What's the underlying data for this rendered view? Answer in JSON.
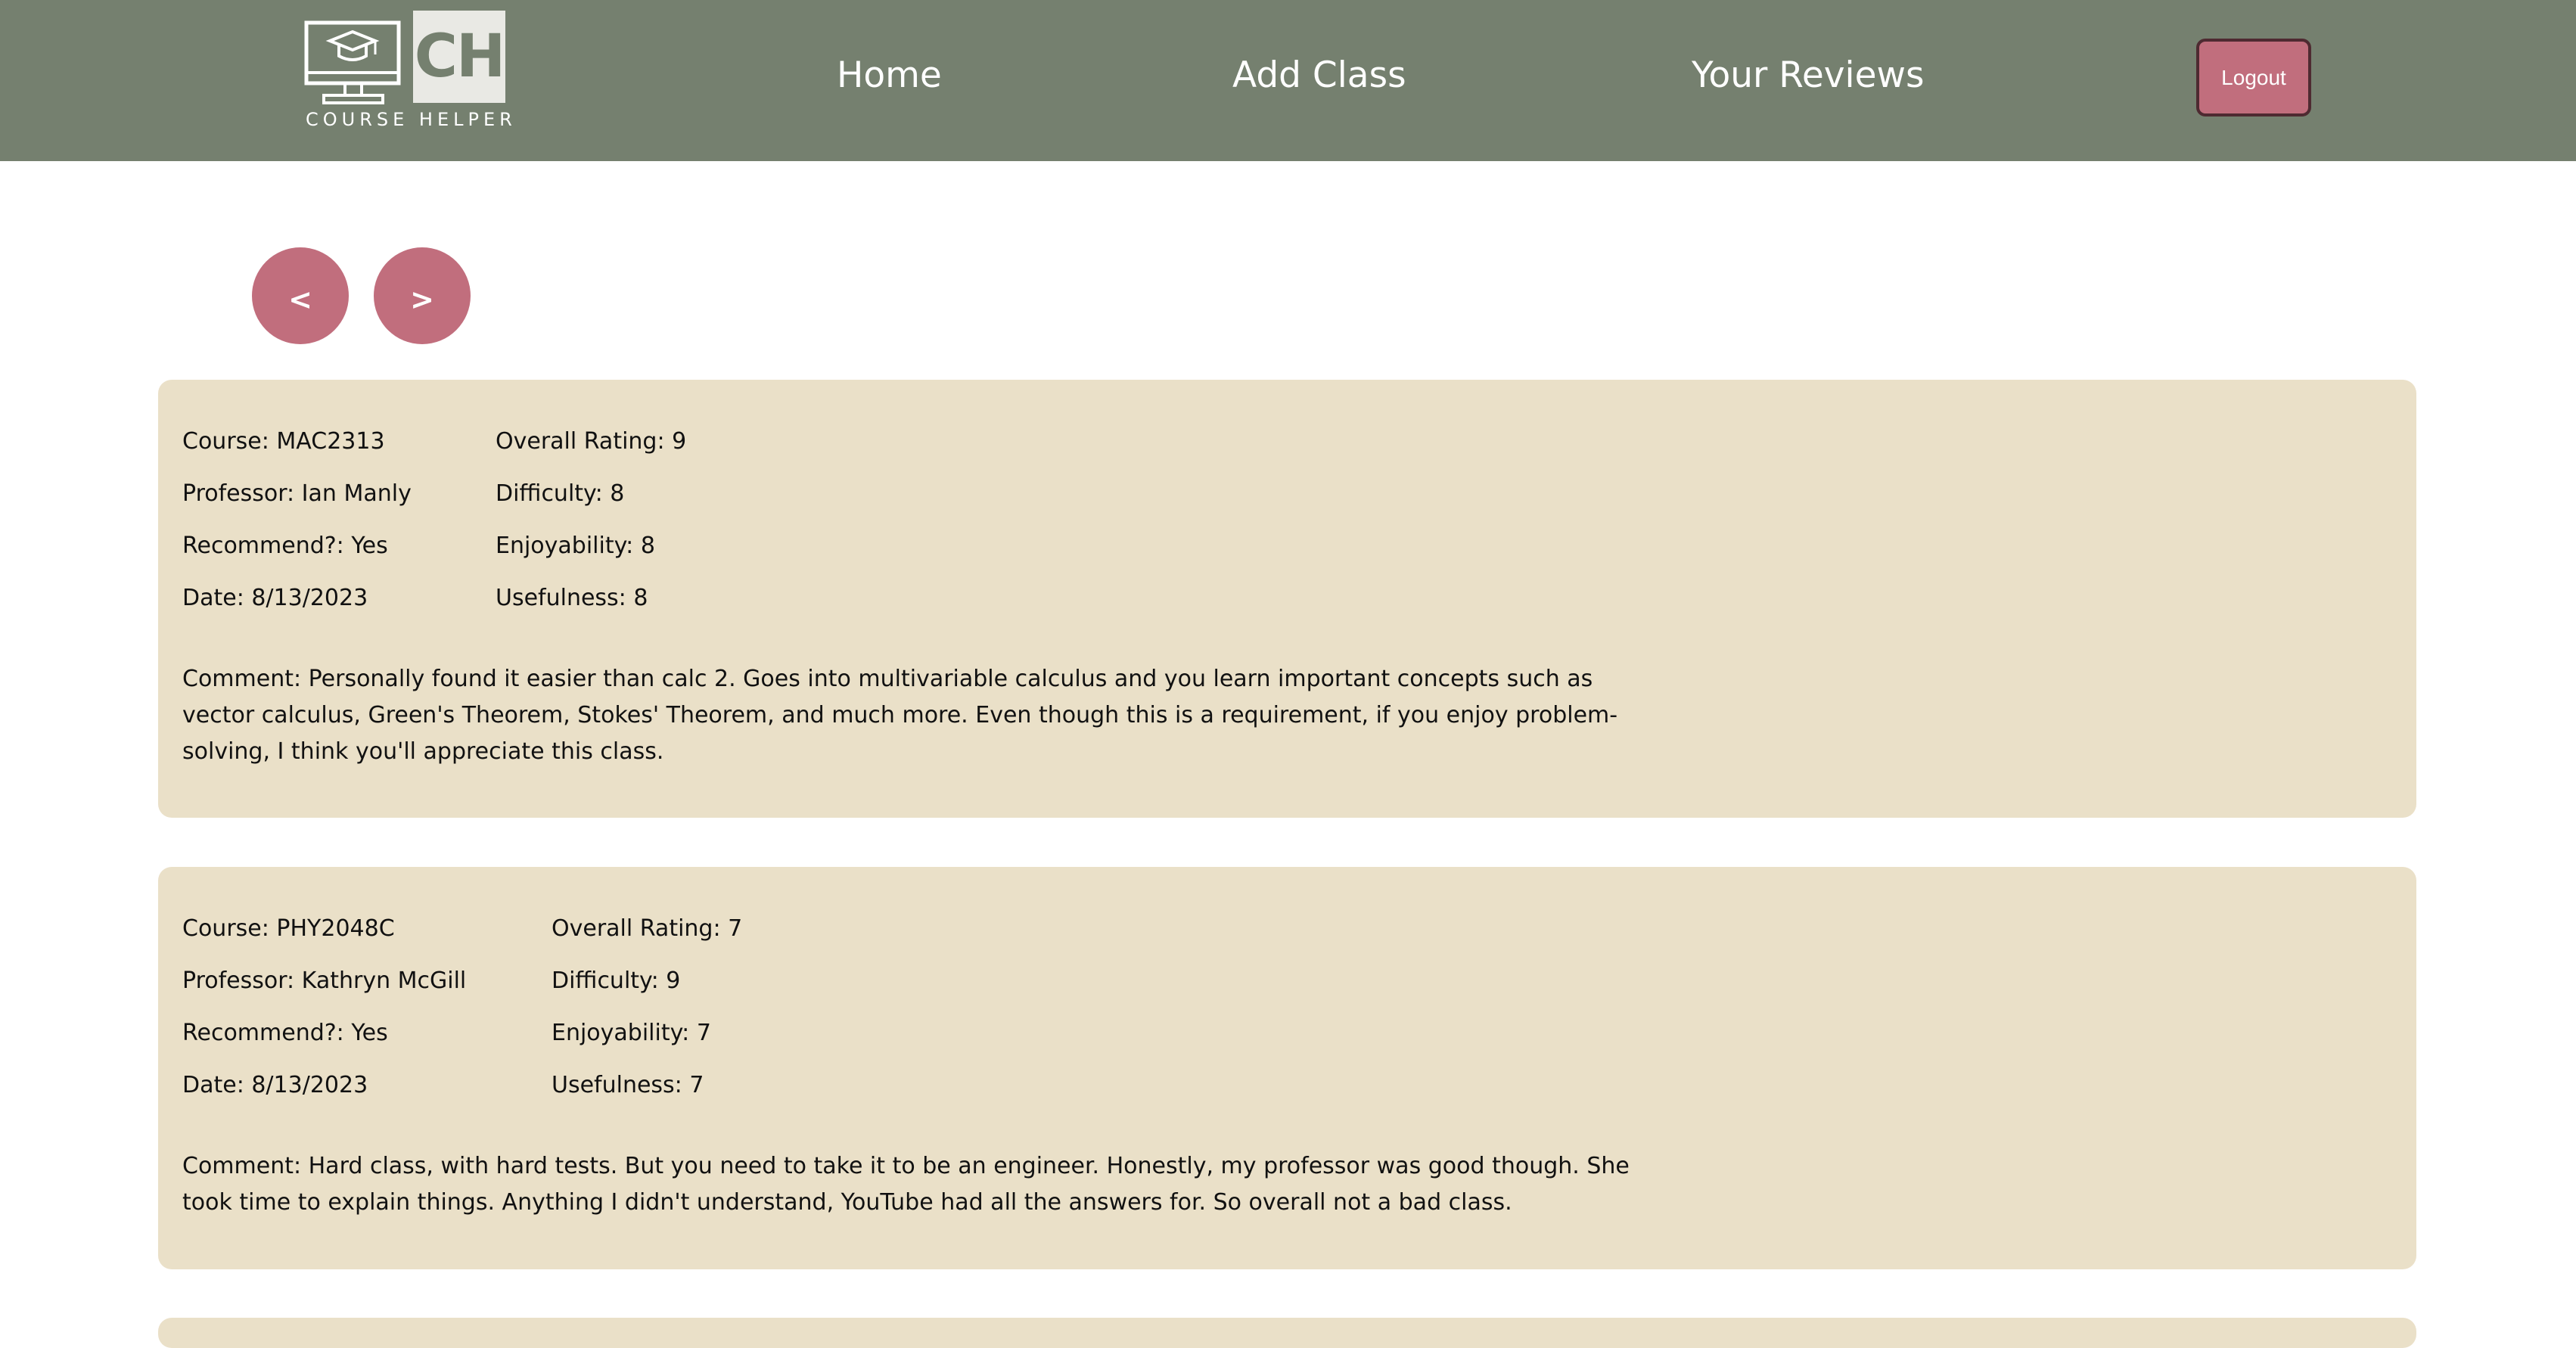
{
  "header": {
    "logo_text": "COURSE HELPER",
    "logo_initials": "CH",
    "nav": {
      "home": "Home",
      "add_class": "Add Class",
      "your_reviews": "Your Reviews"
    },
    "logout_label": "Logout"
  },
  "pager": {
    "prev_label": "<",
    "next_label": ">"
  },
  "colors": {
    "header_bg": "#75806f",
    "accent": "#c16e7d",
    "card_bg": "#eae0c8"
  },
  "reviews": [
    {
      "course": "Course: MAC2313",
      "professor": "Professor: Ian Manly",
      "recommend": "Recommend?: Yes",
      "date": "Date: 8/13/2023",
      "overall": "Overall Rating: 9",
      "difficulty": "Difficulty: 8",
      "enjoyability": "Enjoyability: 8",
      "usefulness": "Usefulness: 8",
      "comment": "Comment: Personally found it easier than calc 2. Goes into multivariable calculus and you learn important concepts such as vector calculus, Green's Theorem, Stokes' Theorem, and much more. Even though this is a requirement, if you enjoy problem-solving, I think you'll appreciate this class."
    },
    {
      "course": "Course: PHY2048C",
      "professor": "Professor: Kathryn McGill",
      "recommend": "Recommend?: Yes",
      "date": "Date: 8/13/2023",
      "overall": "Overall Rating: 7",
      "difficulty": "Difficulty: 9",
      "enjoyability": "Enjoyability: 7",
      "usefulness": "Usefulness: 7",
      "comment": "Comment: Hard class, with hard tests. But you need to take it to be an engineer. Honestly, my professor was good though. She took time to explain things. Anything I didn't understand, YouTube had all the answers for. So overall not a bad class."
    }
  ]
}
